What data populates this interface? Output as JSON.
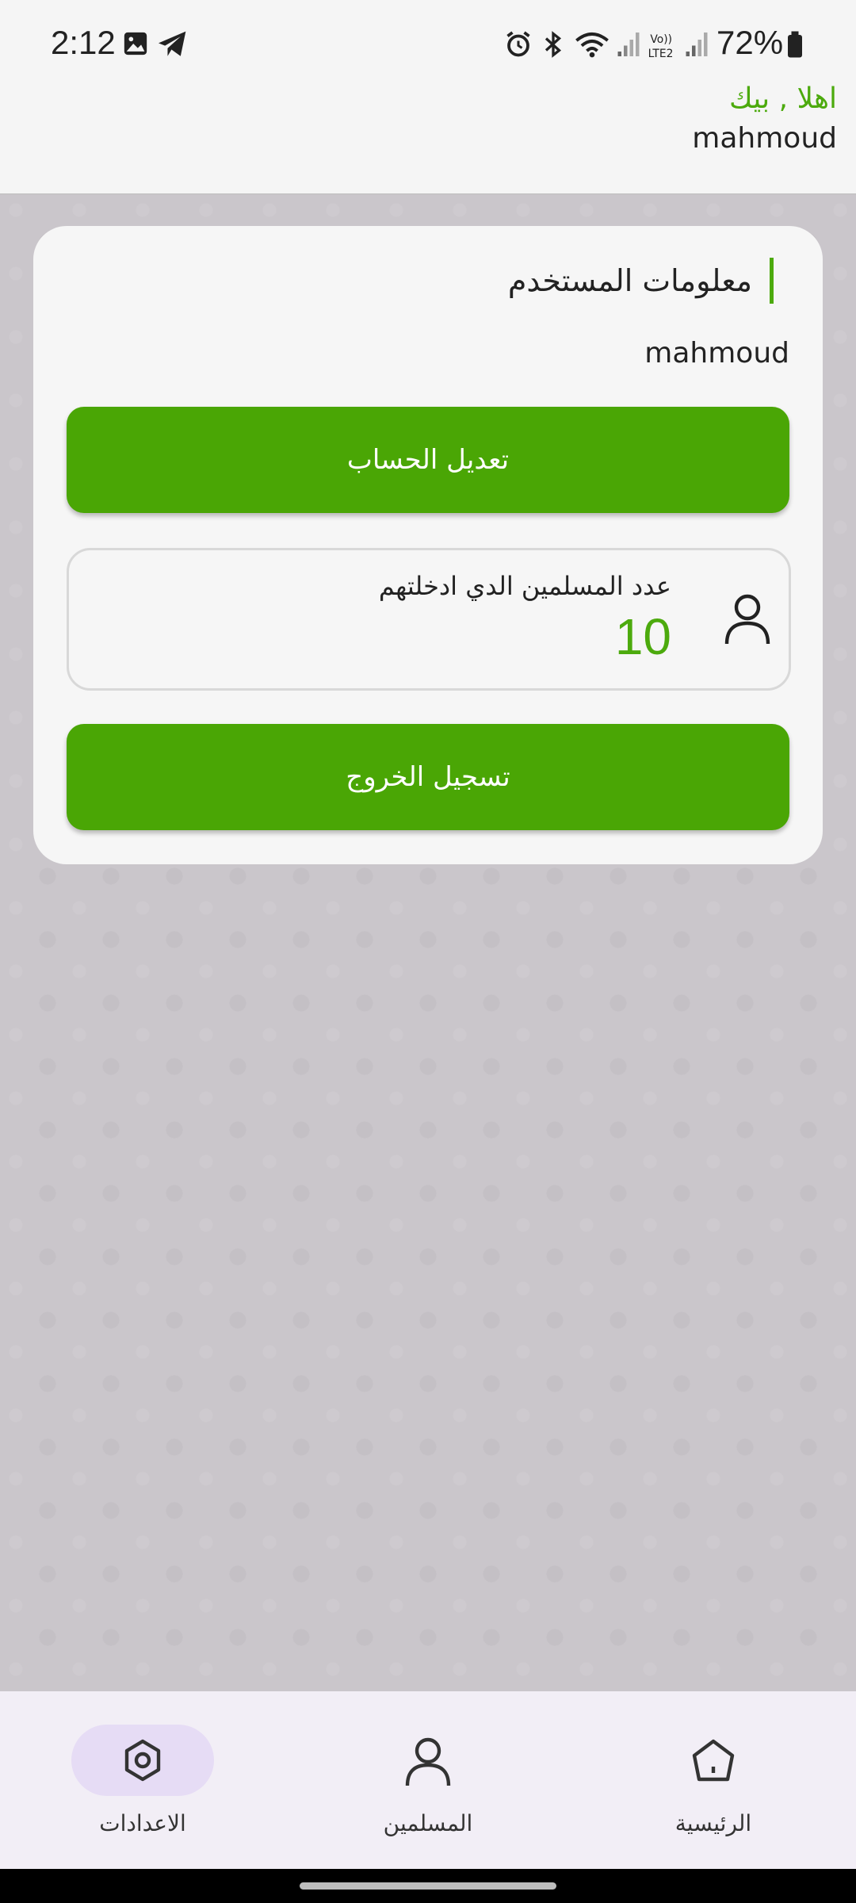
{
  "status_bar": {
    "time": "2:12",
    "battery": "72%",
    "icons": [
      "image-icon",
      "telegram-icon",
      "alarm-icon",
      "bluetooth-icon",
      "wifi-icon",
      "signal-icon",
      "volte-icon",
      "signal-icon",
      "battery-icon"
    ]
  },
  "header": {
    "greeting": "اهلا , بيك",
    "username": "mahmoud"
  },
  "card": {
    "title": "معلومات المستخدم",
    "username": "mahmoud",
    "edit_button": "تعديل الحساب",
    "stat_label": "عدد المسلمين الدي ادخلتهم",
    "stat_value": "10",
    "logout_button": "تسجيل الخروج"
  },
  "nav": {
    "items": [
      {
        "label": "الاعدادات",
        "icon": "settings-icon",
        "active": true
      },
      {
        "label": "المسلمين",
        "icon": "person-icon",
        "active": false
      },
      {
        "label": "الرئيسية",
        "icon": "home-icon",
        "active": false
      }
    ]
  },
  "colors": {
    "accent": "#4caa0d",
    "button": "#4aa605",
    "nav_active": "#e6dcf5"
  }
}
